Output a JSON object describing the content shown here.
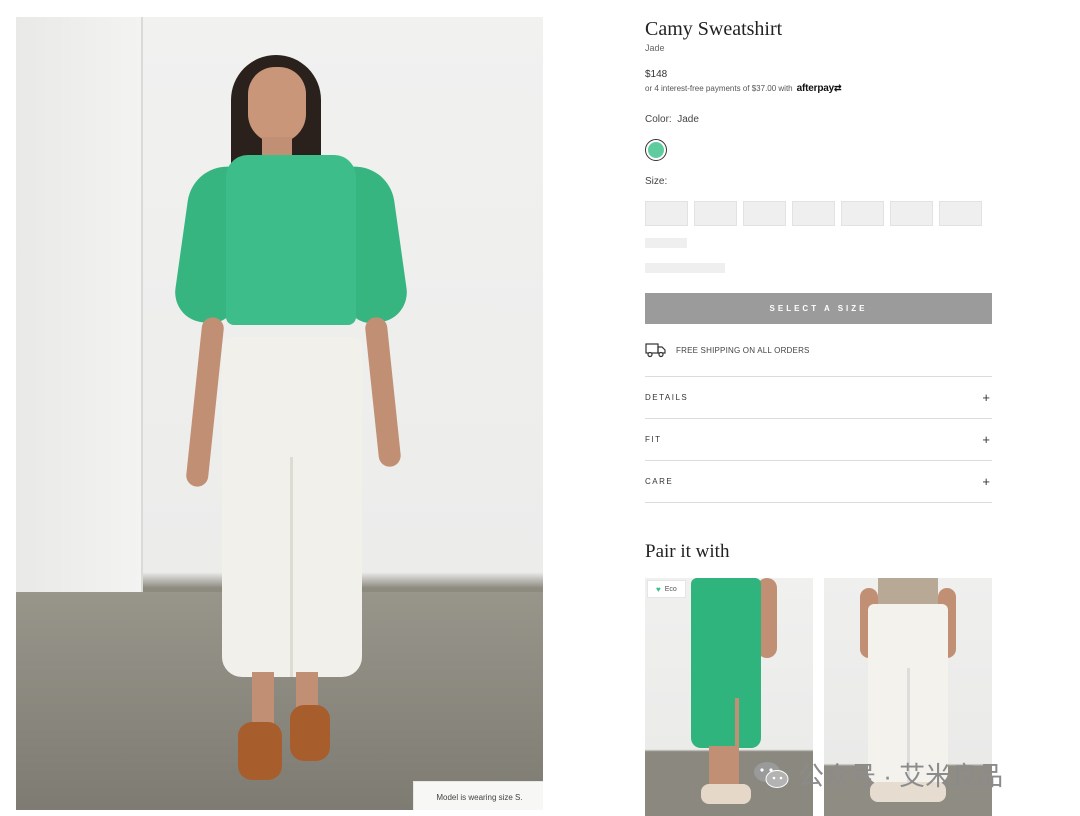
{
  "hero": {
    "size_note": "Model is wearing size S."
  },
  "product": {
    "title": "Camy Sweatshirt",
    "color_name": "Jade",
    "price": "$148",
    "installments_text": "or 4 interest-free payments of $37.00 with",
    "afterpay_logo": "afterpay",
    "color_label": "Color:",
    "color_value": "Jade",
    "swatch_color": "#5fcc9f",
    "size_label": "Size:",
    "size_options_count_visible": 7,
    "select_button": "SELECT A SIZE",
    "shipping_text": "FREE SHIPPING ON ALL ORDERS",
    "accordion": [
      {
        "label": "DETAILS",
        "icon": "plus-icon"
      },
      {
        "label": "FIT",
        "icon": "plus-icon"
      },
      {
        "label": "CARE",
        "icon": "plus-icon"
      }
    ]
  },
  "pair": {
    "title": "Pair it with",
    "eco_badge": "Eco"
  },
  "watermark": {
    "text": "公众号 · 艾米良品"
  },
  "colors": {
    "jade": "#3dbd89",
    "button_disabled": "#9b9b9b",
    "divider": "#dcdcdc"
  }
}
